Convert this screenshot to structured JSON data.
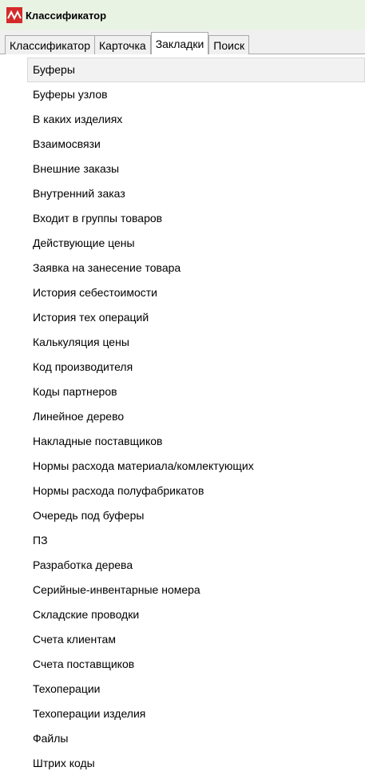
{
  "window": {
    "title": "Классификатор",
    "icon": "app-logo-icon",
    "colors": {
      "titlebar_bg": "#e9f3e4",
      "icon_bg": "#d42a2a"
    }
  },
  "tabs": [
    {
      "label": "Классификатор",
      "active": false
    },
    {
      "label": "Карточка",
      "active": false
    },
    {
      "label": "Закладки",
      "active": true
    },
    {
      "label": "Поиск",
      "active": false
    }
  ],
  "bookmarks": {
    "selected": "Буферы",
    "items": [
      "Буферы",
      "Буферы узлов",
      "В каких изделиях",
      "Взаимосвязи",
      "Внешние заказы",
      "Внутренний заказ",
      "Входит в группы товаров",
      "Действующие цены",
      "Заявка на занесение товара",
      "История себестоимости",
      "История тех операций",
      "Калькуляция цены",
      "Код производителя",
      "Коды партнеров",
      "Линейное дерево",
      "Накладные поставщиков",
      "Нормы расхода материала/комлектующих",
      "Нормы расхода полуфабрикатов",
      "Очередь под буферы",
      "ПЗ",
      "Разработка дерева",
      "Серийные-инвентарные номера",
      "Складские проводки",
      "Счета клиентам",
      "Счета поставщиков",
      "Техоперации",
      "Техоперации изделия",
      "Файлы",
      "Штрих коды"
    ]
  }
}
